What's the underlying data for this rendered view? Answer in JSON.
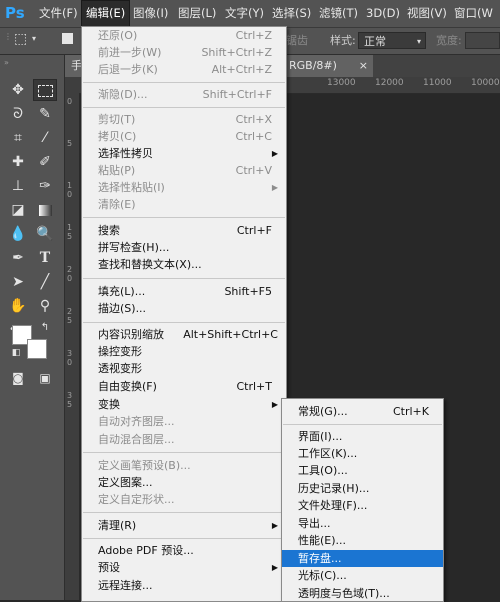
{
  "menubar": {
    "logo": "Ps",
    "items": [
      {
        "label": "文件(F)"
      },
      {
        "label": "编辑(E)"
      },
      {
        "label": "图像(I)"
      },
      {
        "label": "图层(L)"
      },
      {
        "label": "文字(Y)"
      },
      {
        "label": "选择(S)"
      },
      {
        "label": "滤镜(T)"
      },
      {
        "label": "3D(D)"
      },
      {
        "label": "视图(V)"
      },
      {
        "label": "窗口(W"
      }
    ],
    "minimize": "—"
  },
  "options_bar": {
    "partial_label": "锯齿",
    "style_label": "样式:",
    "style_value": "正常",
    "width_label": "宽度:"
  },
  "document": {
    "tab_left": "手",
    "tab_right": "RGB/8#)",
    "close_icon": "×",
    "ruler_h": [
      "13000",
      "12000",
      "11000",
      "10000"
    ],
    "ruler_v": [
      "0",
      "5",
      "1",
      "0",
      "1",
      "5",
      "2",
      "0",
      "2",
      "5",
      "3",
      "0",
      "3",
      "5"
    ]
  },
  "edit_menu": {
    "items": [
      {
        "label": "还原(O)",
        "shortcut": "Ctrl+Z"
      },
      {
        "label": "前进一步(W)",
        "shortcut": "Shift+Ctrl+Z"
      },
      {
        "label": "后退一步(K)",
        "shortcut": "Alt+Ctrl+Z"
      },
      {
        "label": "渐隐(D)...",
        "shortcut": "Shift+Ctrl+F"
      },
      {
        "label": "剪切(T)",
        "shortcut": "Ctrl+X"
      },
      {
        "label": "拷贝(C)",
        "shortcut": "Ctrl+C"
      },
      {
        "label": "选择性拷贝",
        "shortcut": ""
      },
      {
        "label": "粘贴(P)",
        "shortcut": "Ctrl+V"
      },
      {
        "label": "选择性粘贴(I)",
        "shortcut": ""
      },
      {
        "label": "清除(E)",
        "shortcut": ""
      },
      {
        "label": "搜索",
        "shortcut": "Ctrl+F"
      },
      {
        "label": "拼写检查(H)...",
        "shortcut": ""
      },
      {
        "label": "查找和替换文本(X)...",
        "shortcut": ""
      },
      {
        "label": "填充(L)...",
        "shortcut": "Shift+F5"
      },
      {
        "label": "描边(S)...",
        "shortcut": ""
      },
      {
        "label": "内容识别缩放",
        "shortcut": "Alt+Shift+Ctrl+C"
      },
      {
        "label": "操控变形",
        "shortcut": ""
      },
      {
        "label": "透视变形",
        "shortcut": ""
      },
      {
        "label": "自由变换(F)",
        "shortcut": "Ctrl+T"
      },
      {
        "label": "变换",
        "shortcut": ""
      },
      {
        "label": "自动对齐图层...",
        "shortcut": ""
      },
      {
        "label": "自动混合图层...",
        "shortcut": ""
      },
      {
        "label": "定义画笔预设(B)...",
        "shortcut": ""
      },
      {
        "label": "定义图案...",
        "shortcut": ""
      },
      {
        "label": "定义自定形状...",
        "shortcut": ""
      },
      {
        "label": "清理(R)",
        "shortcut": ""
      },
      {
        "label": "Adobe PDF 预设...",
        "shortcut": ""
      },
      {
        "label": "预设",
        "shortcut": ""
      },
      {
        "label": "远程连接...",
        "shortcut": ""
      }
    ]
  },
  "preferences_submenu": {
    "items": [
      {
        "label": "常规(G)...",
        "shortcut": "Ctrl+K"
      },
      {
        "label": "界面(I)..."
      },
      {
        "label": "工作区(K)..."
      },
      {
        "label": "工具(O)..."
      },
      {
        "label": "历史记录(H)..."
      },
      {
        "label": "文件处理(F)..."
      },
      {
        "label": "导出..."
      },
      {
        "label": "性能(E)..."
      },
      {
        "label": "暂存盘..."
      },
      {
        "label": "光标(C)..."
      },
      {
        "label": "透明度与色域(T)..."
      }
    ]
  },
  "colors": {
    "highlight": "#1b75d2",
    "menu_bg": "#f0f0f0",
    "app_bg": "#535353"
  }
}
